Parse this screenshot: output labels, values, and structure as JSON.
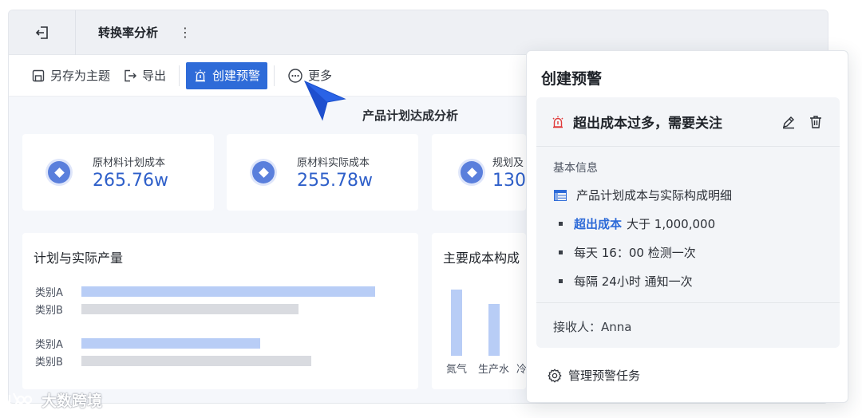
{
  "header": {
    "title": "转换率分析",
    "more_glyph": "⋮"
  },
  "toolbar": {
    "save_as_theme": "另存为主题",
    "export": "导出",
    "create_alert": "创建预警",
    "more": "更多"
  },
  "report": {
    "title": "产品计划达成分析"
  },
  "kpis": [
    {
      "label": "原材料计划成本",
      "value": "265.76w"
    },
    {
      "label": "原材料实际成本",
      "value": "255.78w"
    },
    {
      "label": "规划及",
      "value": "130."
    }
  ],
  "chart_left": {
    "title": "计划与实际产量",
    "chart_data": {
      "type": "bar",
      "orientation": "horizontal",
      "groups": [
        {
          "bars": [
            {
              "label": "类别A",
              "value": 0.92,
              "color": "#b8cdf6"
            },
            {
              "label": "类别B",
              "value": 0.68,
              "color": "#d9dbe0"
            }
          ]
        },
        {
          "bars": [
            {
              "label": "类别A",
              "value": 0.56,
              "color": "#b8cdf6"
            },
            {
              "label": "类别B",
              "value": 0.72,
              "color": "#d9dbe0"
            }
          ]
        }
      ]
    }
  },
  "chart_right": {
    "title": "主要成本构成",
    "chart_data": {
      "type": "bar",
      "categories": [
        "氮气",
        "生产水",
        "冷"
      ],
      "values": [
        0.85,
        0.66,
        0
      ]
    }
  },
  "popup": {
    "title": "创建预警",
    "alert_name": "超出成本过多，需要关注",
    "section_label": "基本信息",
    "table_name": "产品计划成本与实际构成明细",
    "condition_keyword": "超出成本",
    "condition_text": "大于 1,000,000",
    "schedule": "每天 16：00 检测一次",
    "interval": "每隔 24小时 通知一次",
    "receiver": "接收人：Anna",
    "manage": "管理预警任务"
  },
  "watermark": {
    "text": "大数跨境"
  },
  "colors": {
    "accent": "#2e6bd8",
    "kpi_value": "#2e5fc9",
    "bar_blue": "#b8cdf6",
    "bar_gray": "#d9dbe0",
    "alert_red": "#e03a3a"
  },
  "icons": [
    "exit-icon",
    "save-theme-icon",
    "export-icon",
    "alarm-icon",
    "more-circle-icon",
    "edit-icon",
    "trash-icon",
    "table-icon",
    "gear-icon",
    "cursor-icon"
  ]
}
